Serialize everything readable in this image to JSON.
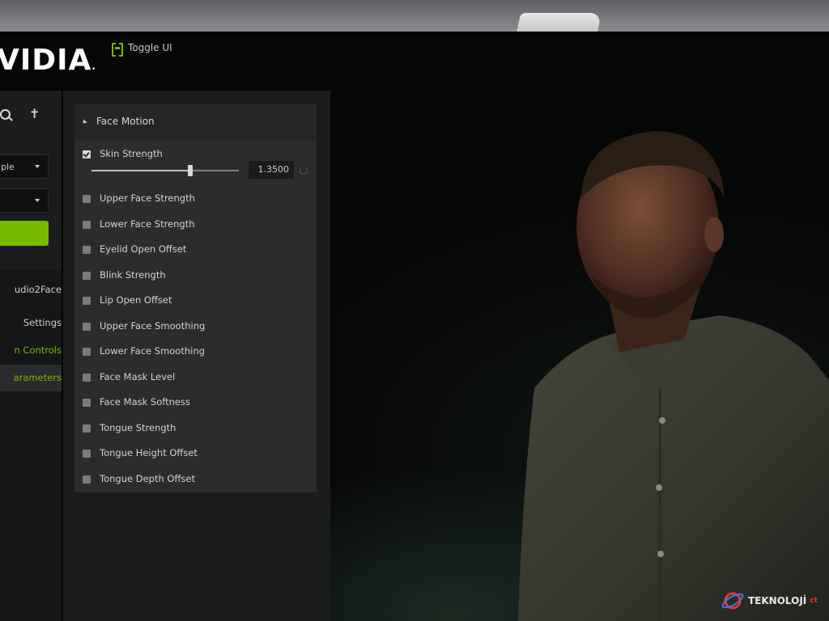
{
  "header": {
    "logo_text": "VIDIA",
    "logo_mark": ".",
    "toggle_ui_label": "Toggle UI",
    "toggle_icon": "toggle-ui-icon"
  },
  "sidebar": {
    "icons": [
      "search-icon",
      "walk-icon"
    ],
    "dropdown1_value": "ple",
    "dropdown2_value": "",
    "items": [
      {
        "label": "udio2Face"
      },
      {
        "label": "Settings"
      },
      {
        "label": "n Controls"
      },
      {
        "label": "arameters"
      }
    ]
  },
  "panel": {
    "section_title": "Face Motion",
    "rows": [
      {
        "label": "Skin Strength",
        "checked": true
      },
      {
        "label": "Upper Face Strength",
        "checked": false
      },
      {
        "label": "Lower Face Strength",
        "checked": false
      },
      {
        "label": "Eyelid Open Offset",
        "checked": false
      },
      {
        "label": "Blink Strength",
        "checked": false
      },
      {
        "label": "Lip Open Offset",
        "checked": false
      },
      {
        "label": "Upper Face Smoothing",
        "checked": false
      },
      {
        "label": "Lower Face Smoothing",
        "checked": false
      },
      {
        "label": "Face Mask Level",
        "checked": false
      },
      {
        "label": "Face Mask Softness",
        "checked": false
      },
      {
        "label": "Tongue Strength",
        "checked": false
      },
      {
        "label": "Tongue Height Offset",
        "checked": false
      },
      {
        "label": "Tongue Depth Offset",
        "checked": false
      }
    ],
    "skin_strength_value": "1.3500",
    "skin_strength_fraction": 0.67
  },
  "watermark": {
    "text": "TEKNOLOJİ",
    "suffix": "ct"
  },
  "colors": {
    "accent": "#76b900",
    "panel": "#2b2c2d",
    "brand_red": "#e2383b"
  }
}
